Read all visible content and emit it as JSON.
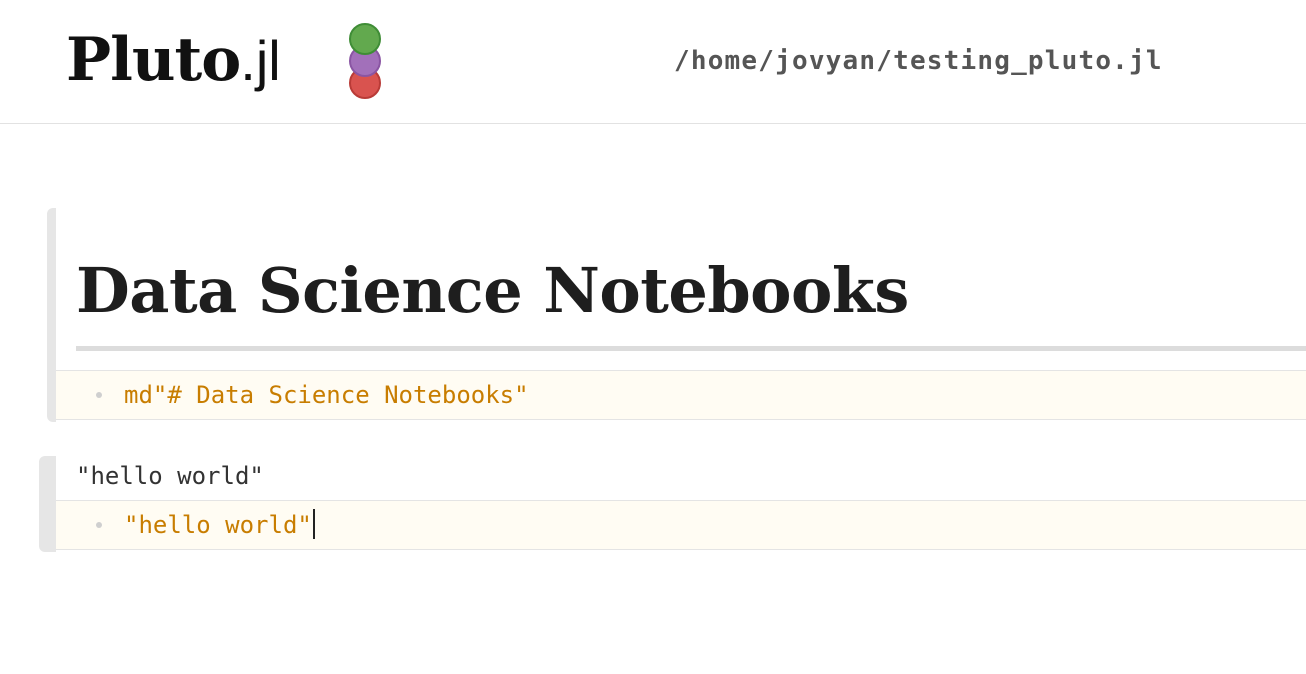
{
  "header": {
    "logo": {
      "name": "Pluto",
      "ext": ".jl",
      "dots": [
        "#62a94e",
        "#a270ba",
        "#d9534f"
      ]
    },
    "path": "/home/jovyan/testing_pluto.jl"
  },
  "cells": [
    {
      "output_heading": "Data Science Notebooks",
      "code": "md\"# Data Science Notebooks\""
    },
    {
      "output_text": "\"hello world\"",
      "code": "\"hello world\""
    }
  ]
}
